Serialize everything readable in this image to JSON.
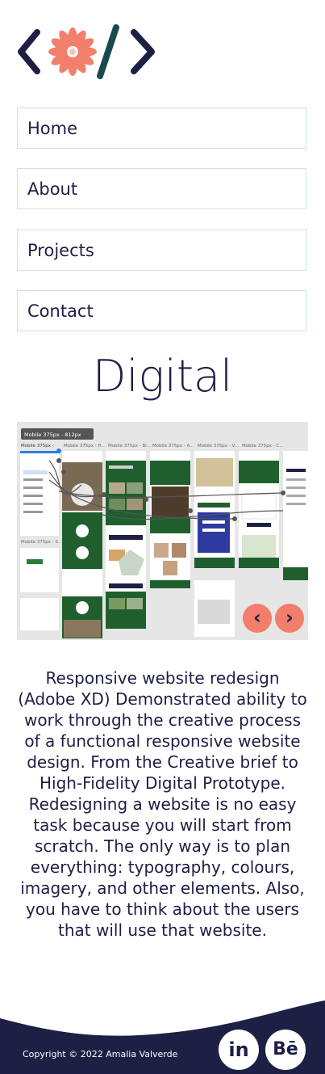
{
  "logo": {
    "icon": "code-flower-logo",
    "colors": {
      "brackets": "#1e1f45",
      "slash": "#1a4a4f",
      "flower": "#f27f6b"
    }
  },
  "nav": {
    "items": [
      {
        "label": "Home"
      },
      {
        "label": "About"
      },
      {
        "label": "Projects"
      },
      {
        "label": "Contact"
      }
    ]
  },
  "page": {
    "title": "Digital"
  },
  "gallery": {
    "toolbar_label": "Mobile 375px - 812px",
    "artboard_labels": [
      "Mobile 375px -",
      "Mobile 375px - H...",
      "Mobile 375px - Bl...",
      "Mobile 375px - A...",
      "Mobile 375px - V...",
      "Mobile 375px - C..."
    ],
    "side_label": "Mobile 375px - S...",
    "prev_icon": "chevron-left-icon",
    "next_icon": "chevron-right-icon",
    "prev_label": "‹",
    "next_label": "›"
  },
  "description": {
    "paragraph1": "Responsive website redesign (Adobe XD) Demonstrated ability to work through the creative process of a functional responsive website design. From the Creative brief to High-Fidelity Digital Prototype.",
    "paragraph2": "Redesigning a website is no easy task because you will start from scratch. The only way is to plan everything: typography, colours, imagery, and other elements. Also, you have to think about the users that will use that website."
  },
  "footer": {
    "copyright": "Copyright © 2022 Amalia Valverde",
    "linkedin_label": "in",
    "behance_label": "Bē",
    "background": "#1e1f45"
  },
  "colors": {
    "accent": "#f27f6b",
    "primary": "#1e1f45",
    "border": "#c9e3e3"
  }
}
